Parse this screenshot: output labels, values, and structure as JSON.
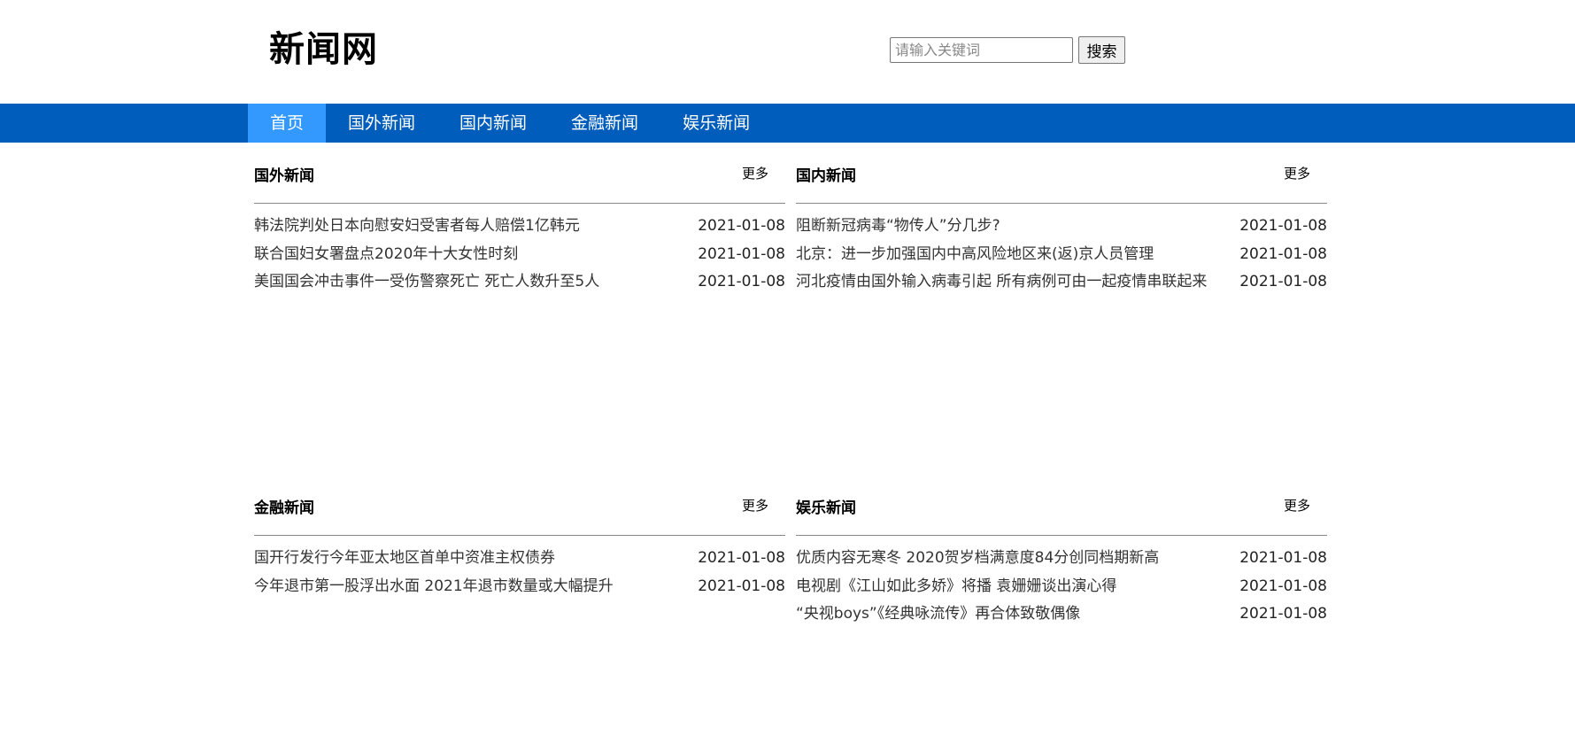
{
  "header": {
    "site_title": "新闻网",
    "search_placeholder": "请输入关键词",
    "search_value": "",
    "search_button": "搜索"
  },
  "nav": {
    "items": [
      {
        "label": "首页",
        "active": true
      },
      {
        "label": "国外新闻",
        "active": false
      },
      {
        "label": "国内新闻",
        "active": false
      },
      {
        "label": "金融新闻",
        "active": false
      },
      {
        "label": "娱乐新闻",
        "active": false
      }
    ]
  },
  "colors": {
    "navbar": "#005dbb",
    "nav_active": "#3399ff"
  },
  "sections": [
    {
      "title": "国外新闻",
      "more": "更多",
      "items": [
        {
          "title": "韩法院判处日本向慰安妇受害者每人赔偿1亿韩元",
          "date": "2021-01-08"
        },
        {
          "title": "联合国妇女署盘点2020年十大女性时刻",
          "date": "2021-01-08"
        },
        {
          "title": "美国国会冲击事件一受伤警察死亡 死亡人数升至5人",
          "date": "2021-01-08"
        }
      ]
    },
    {
      "title": "国内新闻",
      "more": "更多",
      "items": [
        {
          "title": "阻断新冠病毒“物传人”分几步?",
          "date": "2021-01-08"
        },
        {
          "title": "北京：进一步加强国内中高风险地区来(返)京人员管理",
          "date": "2021-01-08"
        },
        {
          "title": "河北疫情由国外输入病毒引起 所有病例可由一起疫情串联起来",
          "date": "2021-01-08"
        }
      ]
    },
    {
      "title": "金融新闻",
      "more": "更多",
      "items": [
        {
          "title": "国开行发行今年亚太地区首单中资准主权债券",
          "date": "2021-01-08"
        },
        {
          "title": "今年退市第一股浮出水面 2021年退市数量或大幅提升",
          "date": "2021-01-08"
        }
      ]
    },
    {
      "title": "娱乐新闻",
      "more": "更多",
      "items": [
        {
          "title": "优质内容无寒冬 2020贺岁档满意度84分创同档期新高",
          "date": "2021-01-08"
        },
        {
          "title": "电视剧《江山如此多娇》将播 袁姗姗谈出演心得",
          "date": "2021-01-08"
        },
        {
          "title": "“央视boys”《经典咏流传》再合体致敬偶像",
          "date": "2021-01-08"
        }
      ]
    }
  ]
}
